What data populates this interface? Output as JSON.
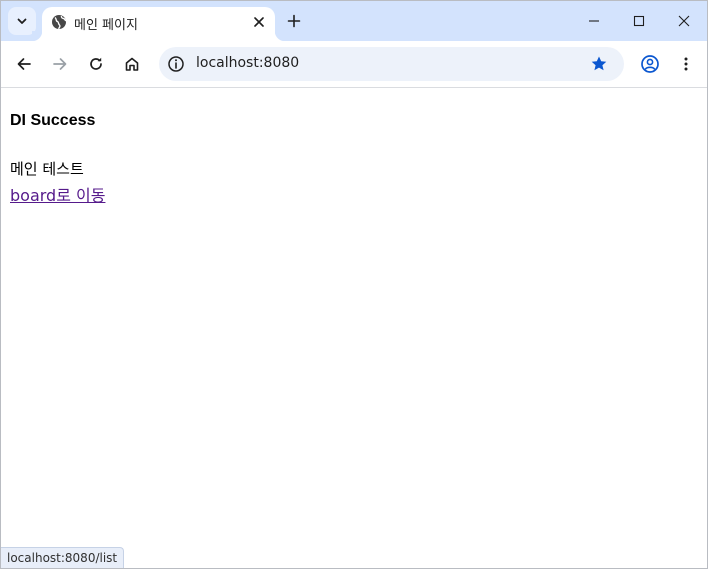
{
  "tab": {
    "title": "메인 페이지"
  },
  "address_bar": {
    "url": "localhost:8080"
  },
  "page": {
    "heading": "DI Success",
    "text": "메인 테스트",
    "link_label": "board로 이동"
  },
  "status_bar": {
    "url": "localhost:8080/list"
  },
  "colors": {
    "tabstrip": "#d3e3fd",
    "omnibox": "#edf2fa",
    "star": "#0b57d0",
    "visited_link": "#551a8b"
  }
}
